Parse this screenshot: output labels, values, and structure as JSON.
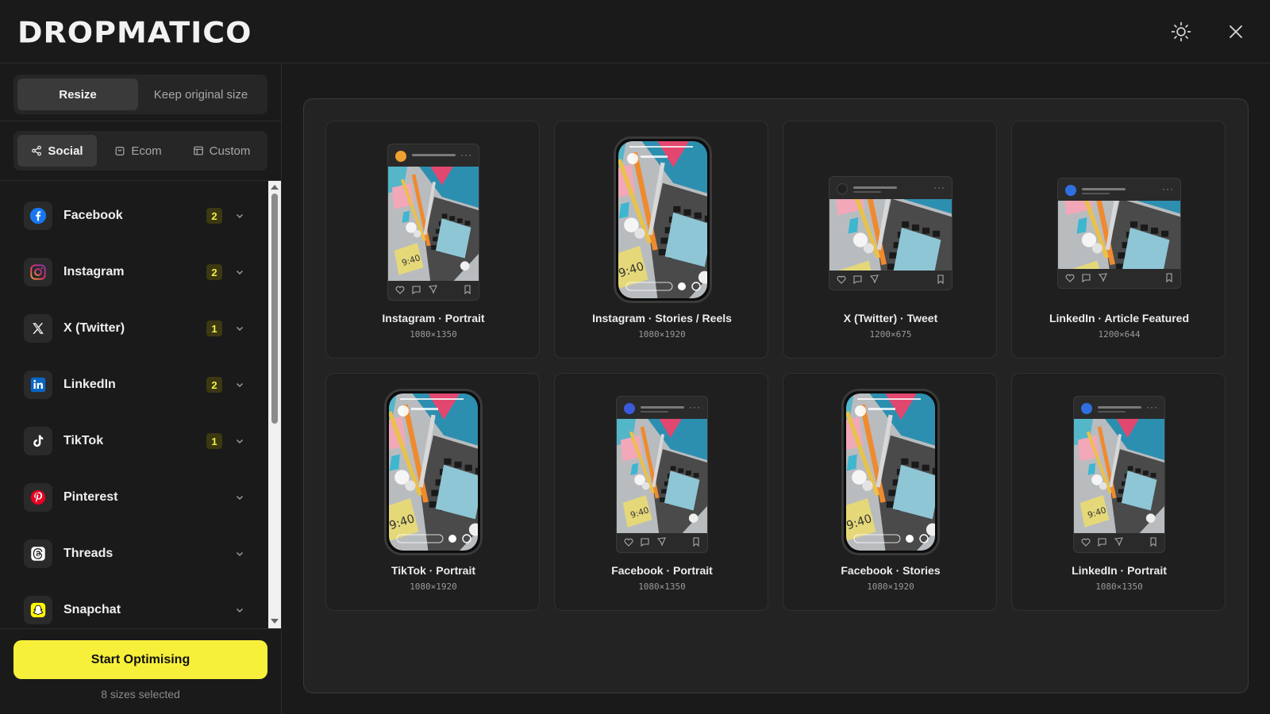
{
  "app": {
    "logo": "DROPMATICO"
  },
  "header": {
    "theme_toggle": "sun-icon",
    "close": "close-icon"
  },
  "resize_mode": {
    "options": [
      {
        "label": "Resize",
        "active": true
      },
      {
        "label": "Keep original size",
        "active": false
      }
    ]
  },
  "category_tabs": [
    {
      "label": "Social",
      "icon": "share-icon",
      "active": true
    },
    {
      "label": "Ecom",
      "icon": "bag-icon",
      "active": false
    },
    {
      "label": "Custom",
      "icon": "layout-icon",
      "active": false
    }
  ],
  "platforms": [
    {
      "label": "Facebook",
      "count": "2",
      "icon": "facebook-icon",
      "color": "#1877F2"
    },
    {
      "label": "Instagram",
      "count": "2",
      "icon": "instagram-icon",
      "color": "#E1306C"
    },
    {
      "label": "X (Twitter)",
      "count": "1",
      "icon": "x-icon",
      "color": "#FFFFFF"
    },
    {
      "label": "LinkedIn",
      "count": "2",
      "icon": "linkedin-icon",
      "color": "#0A66C2"
    },
    {
      "label": "TikTok",
      "count": "1",
      "icon": "tiktok-icon",
      "color": "#FFFFFF"
    },
    {
      "label": "Pinterest",
      "count": "",
      "icon": "pinterest-icon",
      "color": "#E60023"
    },
    {
      "label": "Threads",
      "count": "",
      "icon": "threads-icon",
      "color": "#FFFFFF"
    },
    {
      "label": "Snapchat",
      "count": "",
      "icon": "snapchat-icon",
      "color": "#FFFC00"
    }
  ],
  "footer": {
    "cta_label": "Start Optimising",
    "selected_note": "8 sizes selected"
  },
  "previews": [
    {
      "title": "Instagram · Portrait",
      "size": "1080×1350",
      "style": "post-portrait",
      "avatar_color": "#f0a030"
    },
    {
      "title": "Instagram · Stories / Reels",
      "size": "1080×1920",
      "style": "story"
    },
    {
      "title": "X (Twitter) · Tweet",
      "size": "1200×675",
      "style": "post-wide",
      "avatar_color": "#222222"
    },
    {
      "title": "LinkedIn · Article Featured",
      "size": "1200×644",
      "style": "post-wide",
      "avatar_color": "#2f6fe0"
    },
    {
      "title": "TikTok · Portrait",
      "size": "1080×1920",
      "style": "story"
    },
    {
      "title": "Facebook · Portrait",
      "size": "1080×1350",
      "style": "post-portrait",
      "avatar_color": "#3b5bdb"
    },
    {
      "title": "Facebook · Stories",
      "size": "1080×1920",
      "style": "story"
    },
    {
      "title": "LinkedIn · Portrait",
      "size": "1080×1350",
      "style": "post-portrait",
      "avatar_color": "#2f6fe0"
    }
  ],
  "colors": {
    "accent": "#F7F03B",
    "background": "#1A1A1A",
    "panel": "#232323"
  }
}
